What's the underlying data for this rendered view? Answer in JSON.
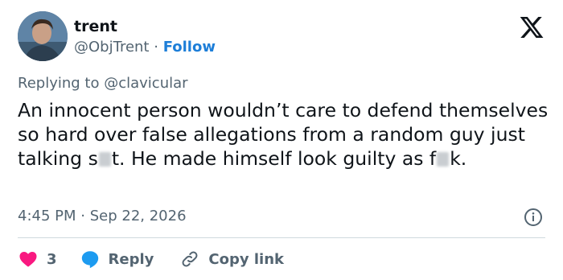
{
  "user": {
    "name": "trent",
    "handle": "@ObjTrent",
    "separator": "·",
    "follow_label": "Follow"
  },
  "tweet": {
    "replying_prefix": "Replying to",
    "replying_to": "@clavicular",
    "text_part1": "An innocent person wouldn’t care to defend themselves so hard over false allegations from a random guy just talking s",
    "text_part2": "t. He made himself look guilty as f",
    "text_part3": "k.",
    "time": "4:45 PM",
    "date_separator": "·",
    "date": "Sep 22, 2026"
  },
  "actions": {
    "like_count": "3",
    "reply_label": "Reply",
    "copy_link_label": "Copy link"
  },
  "colors": {
    "text": "#0f1419",
    "secondary": "#536471",
    "link": "#1d7ed8",
    "heart": "#f91880",
    "reply_bubble": "#1d9bf0",
    "divider": "#cfd9de"
  },
  "icons": [
    "x-logo-icon",
    "info-icon",
    "heart-icon",
    "reply-bubble-icon",
    "link-icon"
  ]
}
